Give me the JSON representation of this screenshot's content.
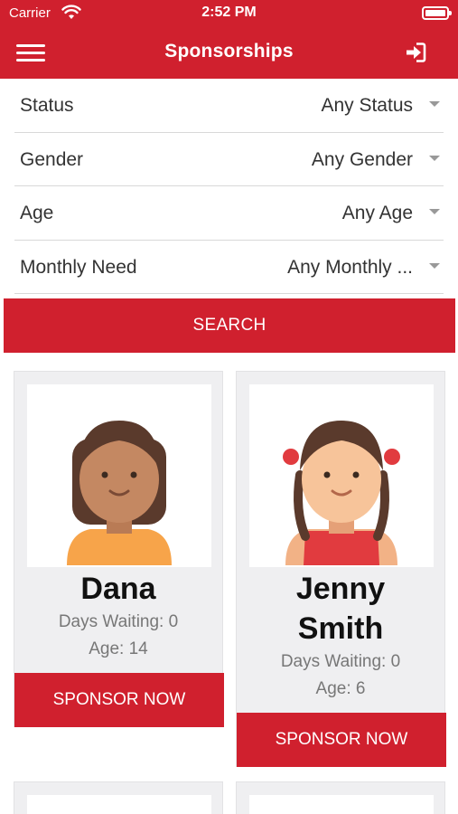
{
  "status_bar": {
    "carrier": "Carrier",
    "time": "2:52 PM",
    "icons": [
      "wifi-icon",
      "battery-icon"
    ]
  },
  "nav": {
    "title": "Sponsorships",
    "left_icon": "hamburger-menu-icon",
    "right_icon": "sign-in-icon",
    "color": "#d0202e"
  },
  "filters": [
    {
      "label": "Status",
      "value": "Any Status"
    },
    {
      "label": "Gender",
      "value": "Any Gender"
    },
    {
      "label": "Age",
      "value": "Any Age"
    },
    {
      "label": "Monthly Need",
      "value": "Any Monthly ..."
    }
  ],
  "search_label": "SEARCH",
  "children": [
    {
      "name": "Dana",
      "days_waiting": "Days Waiting: 0",
      "age": "Age: 14",
      "button": "SPONSOR NOW"
    },
    {
      "name": "Jenny Smith",
      "days_waiting": "Days Waiting: 0",
      "age": "Age: 6",
      "button": "SPONSOR NOW"
    }
  ],
  "colors": {
    "accent": "#d0202e",
    "card_bg": "#efeff1"
  }
}
